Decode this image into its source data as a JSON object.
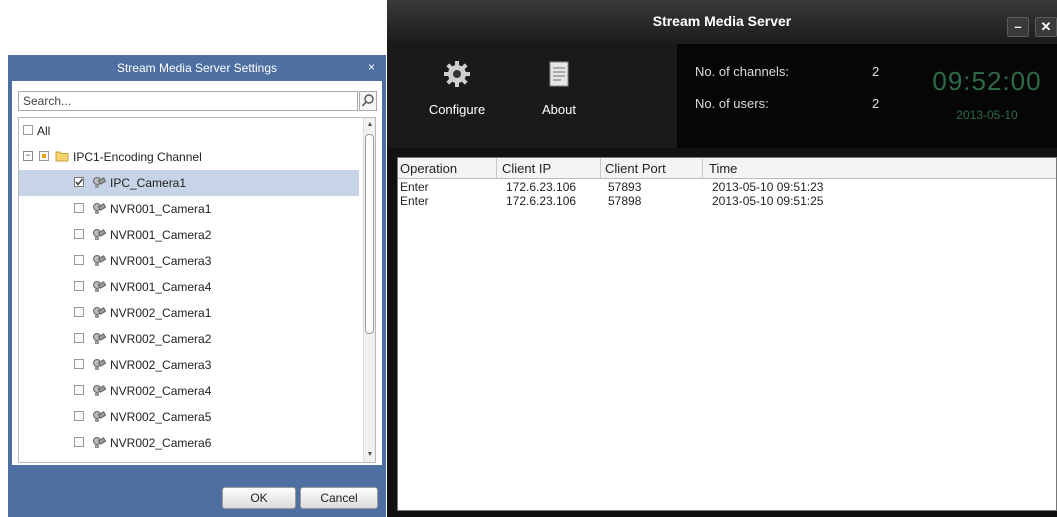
{
  "main": {
    "title": "Stream Media Server",
    "minimize_label": "–",
    "close_label": "✕",
    "toolbar": {
      "configure_label": "Configure",
      "configure_icon": "gear-icon",
      "about_label": "About",
      "about_icon": "document-icon"
    },
    "stats": {
      "channels_label": "No. of channels:",
      "channels_value": "2",
      "users_label": "No. of users:",
      "users_value": "2",
      "clock": "09:52:00",
      "date": "2013-05-10"
    },
    "grid": {
      "columns": [
        "Operation",
        "Client IP",
        "Client Port",
        "Time"
      ],
      "rows": [
        [
          "Enter",
          "172.6.23.106",
          "57893",
          "2013-05-10 09:51:23"
        ],
        [
          "Enter",
          "172.6.23.106",
          "57898",
          "2013-05-10 09:51:25"
        ]
      ]
    }
  },
  "dialog": {
    "title": "Stream Media Server Settings",
    "close_label": "×",
    "search_placeholder": "Search...",
    "tree": {
      "all_label": "All",
      "channel_label": "IPC1-Encoding Channel",
      "cameras": [
        {
          "label": "IPC_Camera1",
          "checked": true,
          "selected": true
        },
        {
          "label": "NVR001_Camera1",
          "checked": false
        },
        {
          "label": "NVR001_Camera2",
          "checked": false
        },
        {
          "label": "NVR001_Camera3",
          "checked": false
        },
        {
          "label": "NVR001_Camera4",
          "checked": false
        },
        {
          "label": "NVR002_Camera1",
          "checked": false
        },
        {
          "label": "NVR002_Camera2",
          "checked": false
        },
        {
          "label": "NVR002_Camera3",
          "checked": false
        },
        {
          "label": "NVR002_Camera4",
          "checked": false
        },
        {
          "label": "NVR002_Camera5",
          "checked": false
        },
        {
          "label": "NVR002_Camera6",
          "checked": false
        }
      ]
    },
    "ok_label": "OK",
    "cancel_label": "Cancel"
  },
  "colors": {
    "dialog_frame": "#4d6fa1",
    "selection": "#c7d3e6",
    "clock": "#2f6a47",
    "main_bg": "#111111"
  }
}
